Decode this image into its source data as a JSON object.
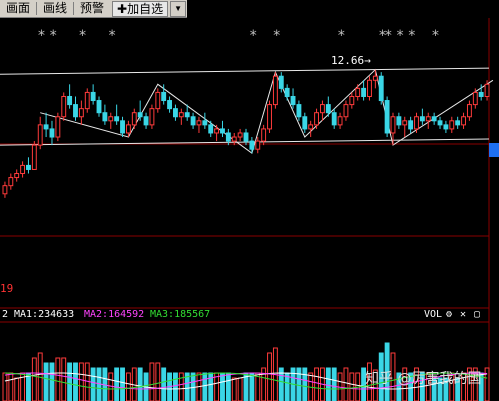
{
  "toolbar": {
    "items": [
      "画面",
      "画线",
      "预警"
    ],
    "add_label": "✚加自选",
    "dropdown_glyph": "▼"
  },
  "chart": {
    "markers_label": "*",
    "peak_label": "12.66→",
    "low_label": "19"
  },
  "indicators": {
    "prefix": "2",
    "ma1": "MA1:234633",
    "ma2": "MA2:164592",
    "ma3": "MA3:185567",
    "vol": "VOL"
  },
  "watermark": "知乎 @厉害我的国",
  "colors": {
    "up": "#ff3b3b",
    "down": "#3ad6e6",
    "ma1": "#ffffff",
    "ma2": "#ff44ff",
    "ma3": "#33dd33",
    "trendline": "#e8e8e8",
    "grid": "#8a0000"
  },
  "chart_data": {
    "type": "candlestick",
    "candles": [
      [
        9.6,
        9.9,
        9.5,
        9.8
      ],
      [
        9.8,
        10.1,
        9.7,
        10.0
      ],
      [
        10.0,
        10.2,
        9.9,
        10.1
      ],
      [
        10.1,
        10.4,
        10.0,
        10.3
      ],
      [
        10.3,
        10.5,
        10.1,
        10.2
      ],
      [
        10.2,
        10.9,
        10.2,
        10.8
      ],
      [
        10.8,
        11.5,
        10.7,
        11.3
      ],
      [
        11.3,
        11.6,
        11.0,
        11.2
      ],
      [
        11.2,
        11.4,
        10.8,
        11.0
      ],
      [
        11.0,
        11.6,
        10.9,
        11.5
      ],
      [
        11.5,
        12.1,
        11.4,
        12.0
      ],
      [
        12.0,
        12.3,
        11.7,
        11.8
      ],
      [
        11.8,
        12.0,
        11.4,
        11.5
      ],
      [
        11.5,
        11.9,
        11.3,
        11.7
      ],
      [
        11.7,
        12.2,
        11.6,
        12.1
      ],
      [
        12.1,
        12.3,
        11.8,
        11.9
      ],
      [
        11.9,
        12.0,
        11.5,
        11.6
      ],
      [
        11.6,
        11.8,
        11.3,
        11.4
      ],
      [
        11.4,
        11.6,
        11.2,
        11.5
      ],
      [
        11.5,
        11.8,
        11.3,
        11.4
      ],
      [
        11.4,
        11.5,
        11.0,
        11.1
      ],
      [
        11.1,
        11.4,
        11.0,
        11.3
      ],
      [
        11.3,
        11.7,
        11.2,
        11.6
      ],
      [
        11.6,
        11.9,
        11.4,
        11.5
      ],
      [
        11.5,
        11.6,
        11.2,
        11.3
      ],
      [
        11.3,
        11.8,
        11.2,
        11.7
      ],
      [
        11.7,
        12.2,
        11.6,
        12.1
      ],
      [
        12.1,
        12.3,
        11.8,
        11.9
      ],
      [
        11.9,
        12.0,
        11.6,
        11.7
      ],
      [
        11.7,
        11.8,
        11.4,
        11.5
      ],
      [
        11.5,
        11.7,
        11.3,
        11.6
      ],
      [
        11.6,
        11.8,
        11.4,
        11.5
      ],
      [
        11.5,
        11.6,
        11.2,
        11.3
      ],
      [
        11.3,
        11.5,
        11.1,
        11.4
      ],
      [
        11.4,
        11.6,
        11.2,
        11.3
      ],
      [
        11.3,
        11.4,
        11.0,
        11.1
      ],
      [
        11.1,
        11.3,
        10.9,
        11.2
      ],
      [
        11.2,
        11.4,
        11.0,
        11.1
      ],
      [
        11.1,
        11.2,
        10.8,
        10.9
      ],
      [
        10.9,
        11.1,
        10.8,
        11.0
      ],
      [
        11.0,
        11.2,
        10.9,
        11.1
      ],
      [
        11.1,
        11.2,
        10.8,
        10.9
      ],
      [
        10.9,
        11.0,
        10.6,
        10.7
      ],
      [
        10.7,
        11.0,
        10.6,
        10.9
      ],
      [
        10.9,
        11.3,
        10.8,
        11.2
      ],
      [
        11.2,
        11.9,
        11.1,
        11.8
      ],
      [
        11.8,
        12.6,
        11.7,
        12.5
      ],
      [
        12.5,
        12.6,
        12.1,
        12.2
      ],
      [
        12.2,
        12.3,
        11.9,
        12.0
      ],
      [
        12.0,
        12.2,
        11.7,
        11.8
      ],
      [
        11.8,
        11.9,
        11.4,
        11.5
      ],
      [
        11.5,
        11.6,
        11.1,
        11.2
      ],
      [
        11.2,
        11.4,
        11.0,
        11.3
      ],
      [
        11.3,
        11.7,
        11.2,
        11.6
      ],
      [
        11.6,
        11.9,
        11.4,
        11.8
      ],
      [
        11.8,
        12.0,
        11.5,
        11.6
      ],
      [
        11.6,
        11.7,
        11.2,
        11.3
      ],
      [
        11.3,
        11.6,
        11.2,
        11.5
      ],
      [
        11.5,
        11.9,
        11.4,
        11.8
      ],
      [
        11.8,
        12.1,
        11.7,
        12.0
      ],
      [
        12.0,
        12.3,
        11.9,
        12.2
      ],
      [
        12.2,
        12.4,
        11.9,
        12.0
      ],
      [
        12.0,
        12.5,
        11.9,
        12.4
      ],
      [
        12.4,
        12.66,
        12.2,
        12.5
      ],
      [
        12.5,
        12.6,
        11.8,
        11.9
      ],
      [
        11.9,
        12.0,
        11.0,
        11.1
      ],
      [
        11.1,
        11.6,
        10.8,
        11.5
      ],
      [
        11.5,
        11.6,
        11.2,
        11.3
      ],
      [
        11.3,
        11.5,
        11.0,
        11.4
      ],
      [
        11.4,
        11.5,
        11.1,
        11.2
      ],
      [
        11.2,
        11.6,
        11.1,
        11.5
      ],
      [
        11.5,
        11.7,
        11.3,
        11.4
      ],
      [
        11.4,
        11.6,
        11.2,
        11.5
      ],
      [
        11.5,
        11.6,
        11.3,
        11.4
      ],
      [
        11.4,
        11.5,
        11.2,
        11.3
      ],
      [
        11.3,
        11.4,
        11.1,
        11.2
      ],
      [
        11.2,
        11.5,
        11.1,
        11.4
      ],
      [
        11.4,
        11.5,
        11.2,
        11.3
      ],
      [
        11.3,
        11.6,
        11.2,
        11.5
      ],
      [
        11.5,
        11.9,
        11.4,
        11.8
      ],
      [
        11.8,
        12.2,
        11.7,
        12.1
      ],
      [
        12.1,
        12.3,
        11.9,
        12.0
      ],
      [
        12.0,
        12.4,
        11.9,
        12.3
      ]
    ],
    "star_index": [
      6,
      8,
      13,
      18,
      42,
      46,
      57,
      64,
      65,
      67,
      69,
      73,
      85
    ]
  }
}
